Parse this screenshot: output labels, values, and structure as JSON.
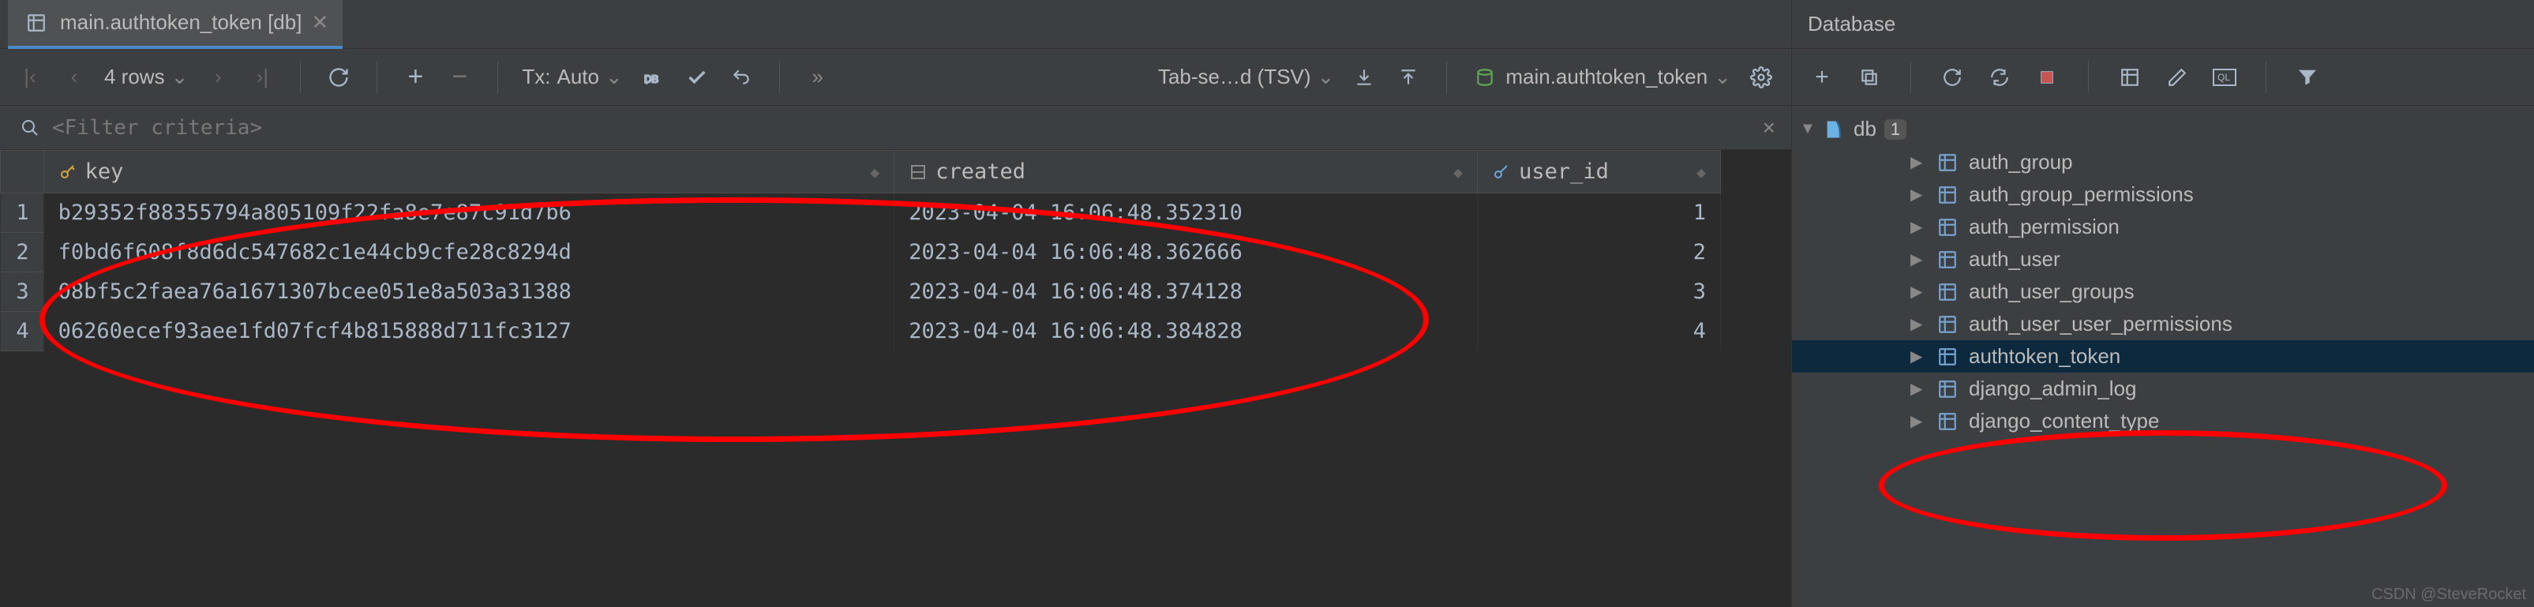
{
  "tab": {
    "title": "main.authtoken_token [db]"
  },
  "toolbar": {
    "rows_label": "4 rows",
    "tx_prefix": "Tx:",
    "tx_mode": "Auto",
    "format_label": "Tab-se…d (TSV)",
    "table_label": "main.authtoken_token"
  },
  "filter": {
    "placeholder": "<Filter criteria>"
  },
  "columns": {
    "key": "key",
    "created": "created",
    "user_id": "user_id"
  },
  "rows": [
    {
      "n": "1",
      "key": "b29352f88355794a805109f22fa8e7e87c91d7b6",
      "created": "2023-04-04 16:06:48.352310",
      "user_id": "1"
    },
    {
      "n": "2",
      "key": "f0bd6f608f8d6dc547682c1e44cb9cfe28c8294d",
      "created": "2023-04-04 16:06:48.362666",
      "user_id": "2"
    },
    {
      "n": "3",
      "key": "08bf5c2faea76a1671307bcee051e8a503a31388",
      "created": "2023-04-04 16:06:48.374128",
      "user_id": "3"
    },
    {
      "n": "4",
      "key": "06260ecef93aee1fd07fcf4b815888d711fc3127",
      "created": "2023-04-04 16:06:48.384828",
      "user_id": "4"
    }
  ],
  "database": {
    "title": "Database",
    "root": "db",
    "root_badge": "1",
    "tables": [
      "auth_group",
      "auth_group_permissions",
      "auth_permission",
      "auth_user",
      "auth_user_groups",
      "auth_user_user_permissions",
      "authtoken_token",
      "django_admin_log",
      "django_content_type"
    ],
    "selected_index": 6
  },
  "watermark": "CSDN @SteveRocket"
}
